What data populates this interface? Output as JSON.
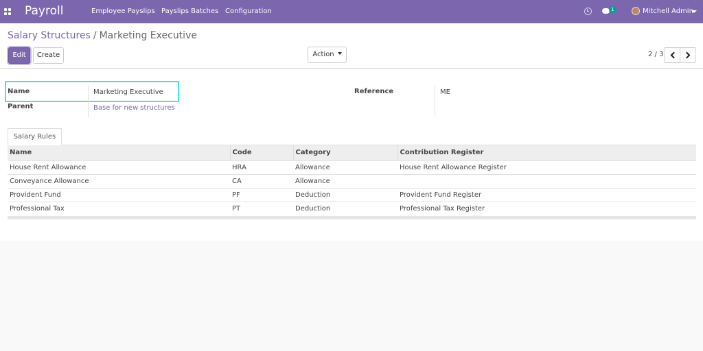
{
  "navbar": {
    "brand": "Payroll",
    "menu": [
      "Employee Payslips",
      "Payslips Batches",
      "Configuration"
    ],
    "chat_count": "1",
    "user_name": "Mitchell Admin",
    "color": "#7c66ae"
  },
  "breadcrumb": {
    "parent": "Salary Structures",
    "separator": "/",
    "current": "Marketing Executive"
  },
  "toolbar": {
    "edit_label": "Edit",
    "create_label": "Create",
    "action_label": "Action"
  },
  "pager": {
    "value": "2 / 3"
  },
  "form": {
    "name_label": "Name",
    "name_value": "Marketing Executive",
    "parent_label": "Parent",
    "parent_value": "Base for new structures",
    "reference_label": "Reference",
    "reference_value": "ME"
  },
  "tabs": {
    "salary_rules": "Salary Rules"
  },
  "rules_table": {
    "columns": [
      "Name",
      "Code",
      "Category",
      "Contribution Register"
    ],
    "rows": [
      [
        "House Rent Allowance",
        "HRA",
        "Allowance",
        "House Rent Allowance Register"
      ],
      [
        "Conveyance Allowance",
        "CA",
        "Allowance",
        ""
      ],
      [
        "Provident Fund",
        "PF",
        "Deduction",
        "Provident Fund Register"
      ],
      [
        "Professional Tax",
        "PT",
        "Deduction",
        "Professional Tax Register"
      ]
    ]
  },
  "icons": [
    "apps-icon",
    "clock-icon",
    "chat-icon",
    "chevron-left-icon",
    "chevron-right-icon",
    "caret-down-icon"
  ]
}
